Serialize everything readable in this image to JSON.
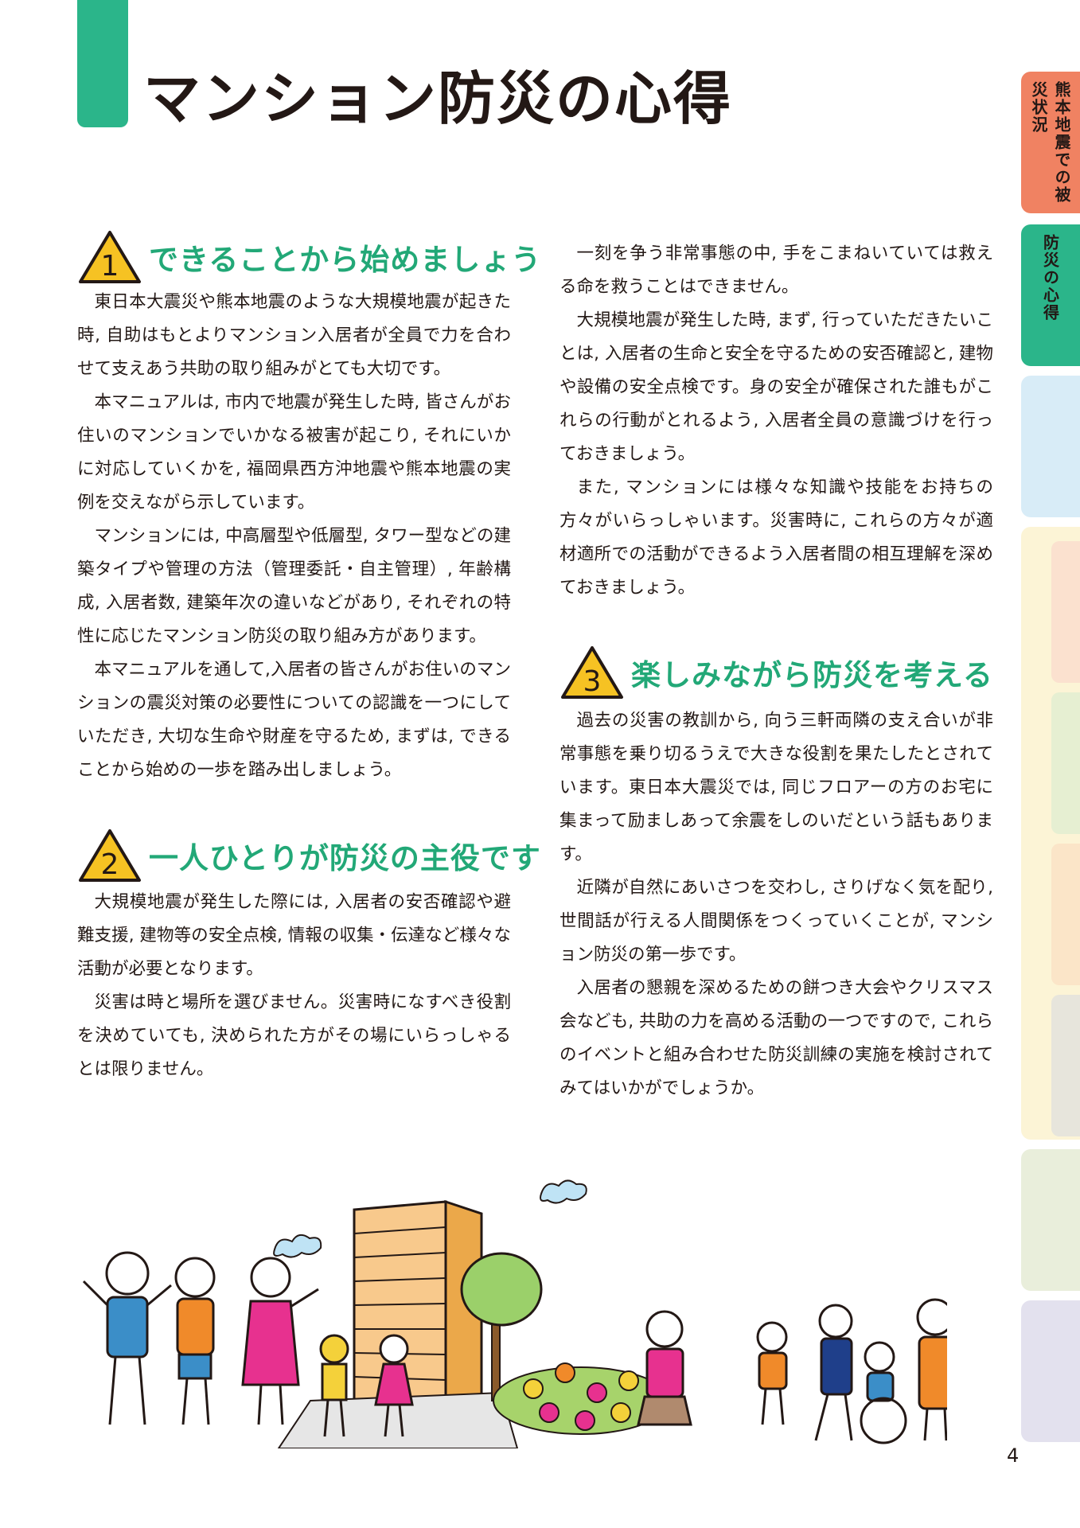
{
  "page": {
    "title": "マンション防災の心得",
    "number": "4"
  },
  "sections": [
    {
      "num": "1",
      "title": "できることから始めましょう",
      "paragraphs": [
        "東日本大震災や熊本地震のような大規模地震が起きた時, 自助はもとよりマンション入居者が全員で力を合わせて支えあう共助の取り組みがとても大切です。",
        "本マニュアルは, 市内で地震が発生した時, 皆さんがお住いのマンションでいかなる被害が起こり, それにいかに対応していくかを, 福岡県西方沖地震や熊本地震の実例を交えながら示しています。",
        "マンションには, 中高層型や低層型, タワー型などの建築タイプや管理の方法（管理委託・自主管理）, 年齢構成, 入居者数, 建築年次の違いなどがあり, それぞれの特性に応じたマンション防災の取り組み方があります。",
        "本マニュアルを通して,入居者の皆さんがお住いのマンションの震災対策の必要性についての認識を一つにしていただき, 大切な生命や財産を守るため, まずは, できることから始めの一歩を踏み出しましょう。"
      ]
    },
    {
      "num": "2",
      "title": "一人ひとりが防災の主役です",
      "paragraphs": [
        "大規模地震が発生した際には, 入居者の安否確認や避難支援, 建物等の安全点検, 情報の収集・伝達など様々な活動が必要となります。",
        "災害は時と場所を選びません。災害時になすべき役割を決めていても, 決められた方がその場にいらっしゃるとは限りません。",
        "一刻を争う非常事態の中, 手をこまねいていては救える命を救うことはできません。",
        "大規模地震が発生した時, まず, 行っていただきたいことは, 入居者の生命と安全を守るための安否確認と, 建物や設備の安全点検です。身の安全が確保された誰もがこれらの行動がとれるよう, 入居者全員の意識づけを行っておきましょう。",
        "また, マンションには様々な知識や技能をお持ちの方々がいらっしゃいます。災害時に, これらの方々が適材適所での活動ができるよう入居者間の相互理解を深めておきましょう。"
      ]
    },
    {
      "num": "3",
      "title": "楽しみながら防災を考える",
      "paragraphs": [
        "過去の災害の教訓から, 向う三軒両隣の支え合いが非常事態を乗り切るうえで大きな役割を果たしたとされています。東日本大震災では, 同じフロアーの方のお宅に集まって励ましあって余震をしのいだという話もあります。",
        "近隣が自然にあいさつを交わし, さりげなく気を配り, 世間話が行える人間関係をつくっていくことが, マンション防災の第一歩です。",
        "入居者の懇親を深めるための餅つき大会やクリスマス会なども, 共助の力を高める活動の一つですので, これらのイベントと組み合わせた防災訓練の実施を検討されてみてはいかがでしょうか。"
      ]
    }
  ],
  "side_tabs": [
    {
      "label": "熊本地震での被災状況",
      "color": "#f08262"
    },
    {
      "label": "防災の心得",
      "color": "#2bb58a"
    },
    {
      "label": "",
      "color": "#d8ecf7"
    },
    {
      "label": "",
      "color": "#fcf4d6"
    },
    {
      "label": "",
      "color": "#e9eedb"
    },
    {
      "label": "",
      "color": "#e3e1ee"
    },
    {
      "label": "",
      "color": "#fbe3ec"
    }
  ],
  "colors": {
    "accent": "#22a877",
    "warning": "#f6c223"
  }
}
